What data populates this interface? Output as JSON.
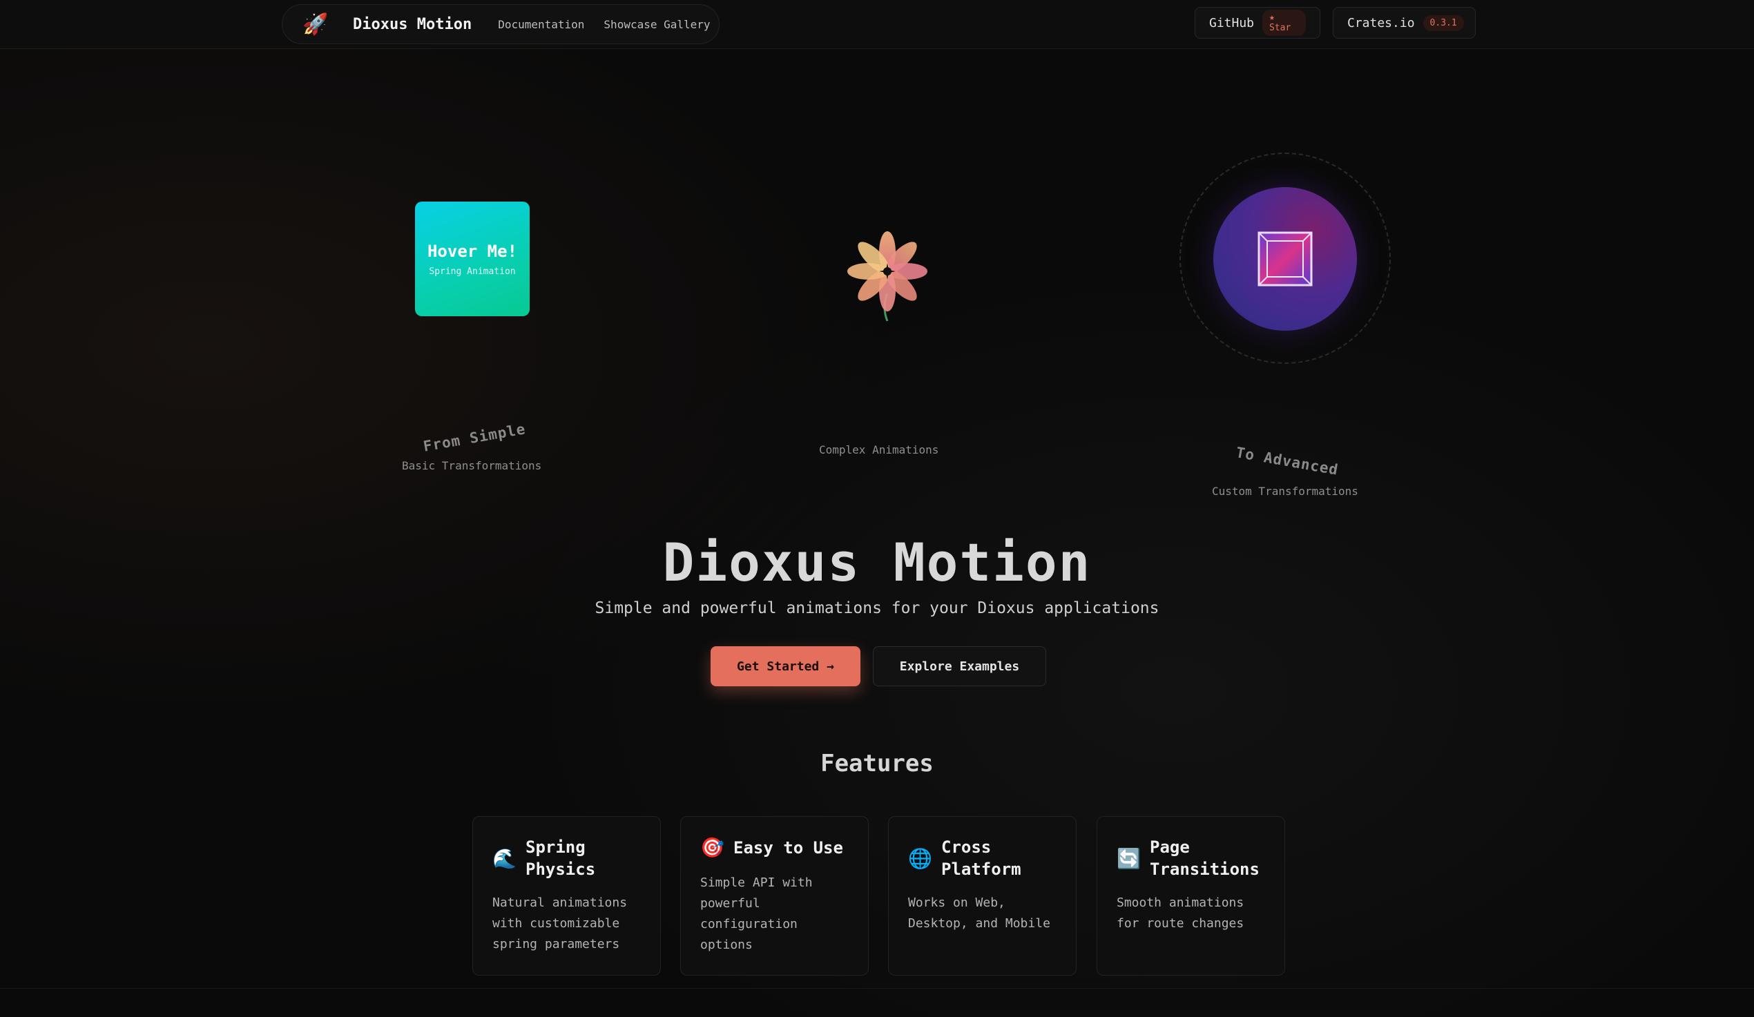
{
  "nav": {
    "brand": "Dioxus Motion",
    "links": [
      "Documentation",
      "Showcase Gallery"
    ],
    "github": {
      "label": "GitHub",
      "badge": "★ Star"
    },
    "crates": {
      "label": "Crates.io",
      "badge": "0.3.1"
    }
  },
  "showcase": {
    "hover_card": {
      "title": "Hover Me!",
      "subtitle": "Spring Animation"
    },
    "simple": {
      "title": "From Simple",
      "subtitle": "Basic Transformations"
    },
    "complex": {
      "subtitle": "Complex Animations"
    },
    "advanced": {
      "title": "To Advanced",
      "subtitle": "Custom Transformations"
    }
  },
  "hero": {
    "title": "Dioxus Motion",
    "subtitle": "Simple and powerful animations for your Dioxus applications",
    "primary_cta": "Get Started →",
    "secondary_cta": "Explore Examples"
  },
  "features": {
    "title": "Features",
    "items": [
      {
        "icon": "🌊",
        "title": "Spring Physics",
        "desc": "Natural animations with customizable spring parameters"
      },
      {
        "icon": "🎯",
        "title": "Easy to Use",
        "desc": "Simple API with powerful configuration options"
      },
      {
        "icon": "🌐",
        "title": "Cross Platform",
        "desc": "Works on Web, Desktop, and Mobile"
      },
      {
        "icon": "🔄",
        "title": "Page Transitions",
        "desc": "Smooth animations for route changes"
      }
    ]
  },
  "colors": {
    "accent": "#e46f5c",
    "card_teal": "#08cfb0",
    "orb_purple": "#4c2a8f"
  }
}
